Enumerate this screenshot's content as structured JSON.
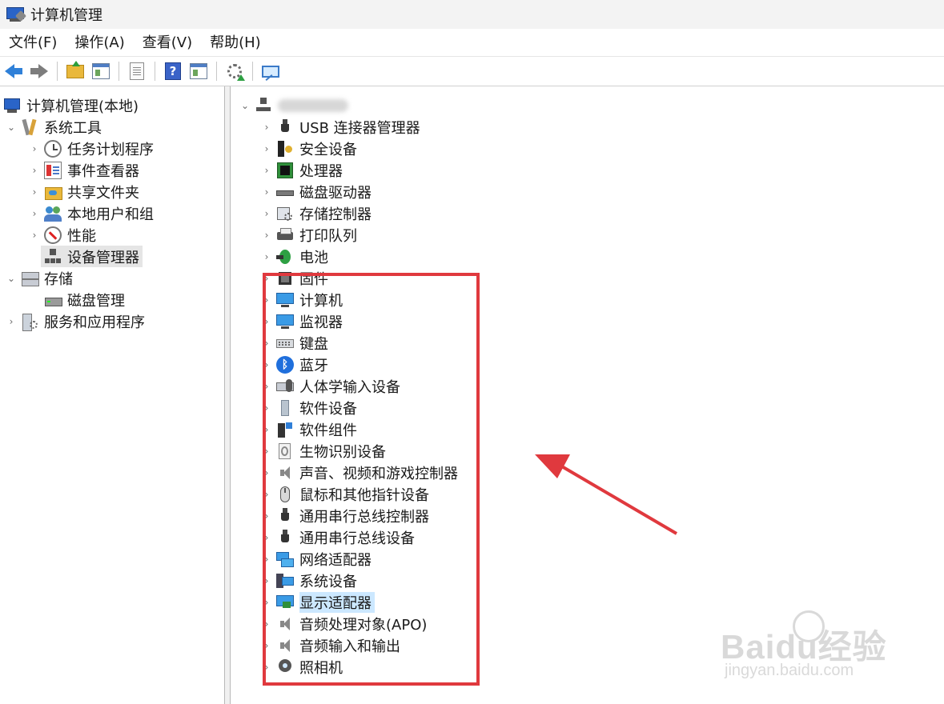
{
  "window": {
    "title": "计算机管理"
  },
  "menu": [
    "文件(F)",
    "操作(A)",
    "查看(V)",
    "帮助(H)"
  ],
  "toolbar": {
    "buttons": [
      {
        "name": "back-button",
        "icon": "back-arrow-icon"
      },
      {
        "name": "forward-button",
        "icon": "forward-arrow-icon"
      },
      {
        "name": "up-folder-button",
        "icon": "up-folder-icon"
      },
      {
        "name": "show-hide-tree-button",
        "icon": "tree-panel-icon"
      },
      {
        "name": "properties-button",
        "icon": "properties-icon"
      },
      {
        "name": "help-button",
        "icon": "help-icon"
      },
      {
        "name": "action-pane-button",
        "icon": "action-pane-icon"
      },
      {
        "name": "update-driver-button",
        "icon": "update-driver-icon"
      },
      {
        "name": "scan-hardware-button",
        "icon": "scan-hardware-icon"
      }
    ],
    "help_glyph": "?"
  },
  "left_tree": {
    "root": "计算机管理(本地)",
    "system_tools": {
      "label": "系统工具",
      "children": [
        "任务计划程序",
        "事件查看器",
        "共享文件夹",
        "本地用户和组",
        "性能",
        "设备管理器"
      ]
    },
    "storage": {
      "label": "存储",
      "children": [
        "磁盘管理"
      ]
    },
    "services": {
      "label": "服务和应用程序"
    }
  },
  "device_tree": {
    "root_name_redacted": true,
    "categories": [
      "USB 连接器管理器",
      "安全设备",
      "处理器",
      "磁盘驱动器",
      "存储控制器",
      "打印队列",
      "电池",
      "固件",
      "计算机",
      "监视器",
      "键盘",
      "蓝牙",
      "人体学输入设备",
      "软件设备",
      "软件组件",
      "生物识别设备",
      "声音、视频和游戏控制器",
      "鼠标和其他指针设备",
      "通用串行总线控制器",
      "通用串行总线设备",
      "网络适配器",
      "系统设备",
      "显示适配器",
      "音频处理对象(APO)",
      "音频输入和输出",
      "照相机"
    ],
    "selected": "显示适配器"
  },
  "glyphs": {
    "chev_right": "›",
    "chev_down": "⌄",
    "bluetooth": "ᛒ"
  },
  "watermark": {
    "brand": "Baidu经验",
    "url": "jingyan.baidu.com"
  },
  "colors": {
    "annotation_red": "#e0393e",
    "selection_blue": "#cce8ff"
  }
}
